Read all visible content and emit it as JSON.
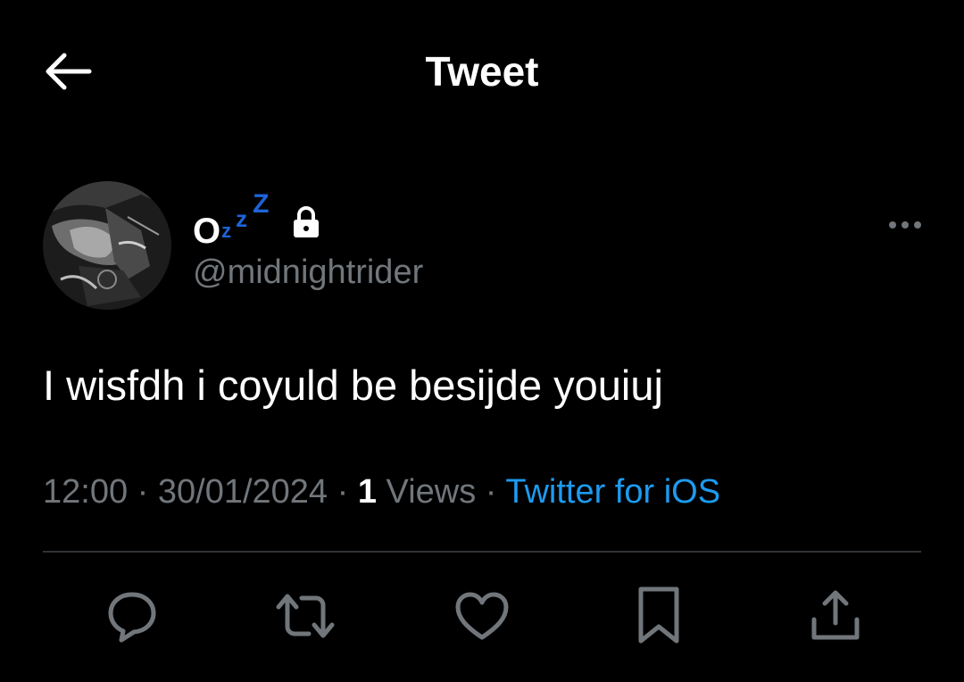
{
  "header": {
    "title": "Tweet",
    "back_icon": "arrow-left-icon"
  },
  "author": {
    "name_prefix": "O",
    "name_emoji": [
      "z",
      "z",
      "Z"
    ],
    "handle": "@midnightrider",
    "protected_icon": "lock-icon",
    "avatar_icon": "avatar-photo"
  },
  "tweet": {
    "text": "I wisfdh i coyuld be besijde youiuj"
  },
  "meta": {
    "time": "12:00",
    "sep1": " · ",
    "date": "30/01/2024",
    "sep2": " · ",
    "views_count": "1",
    "views_label": " Views",
    "sep3": " · ",
    "source": "Twitter for iOS"
  },
  "actions": {
    "reply_icon": "reply-icon",
    "retweet_icon": "retweet-icon",
    "like_icon": "heart-icon",
    "bookmark_icon": "bookmark-icon",
    "share_icon": "share-icon"
  },
  "colors": {
    "background": "#000000",
    "text_primary": "#ffffff",
    "text_secondary": "#71767b",
    "link": "#1d9bf0",
    "divider": "#2f3336",
    "icon": "#71767b",
    "emoji_blue": "#1d64d8"
  }
}
